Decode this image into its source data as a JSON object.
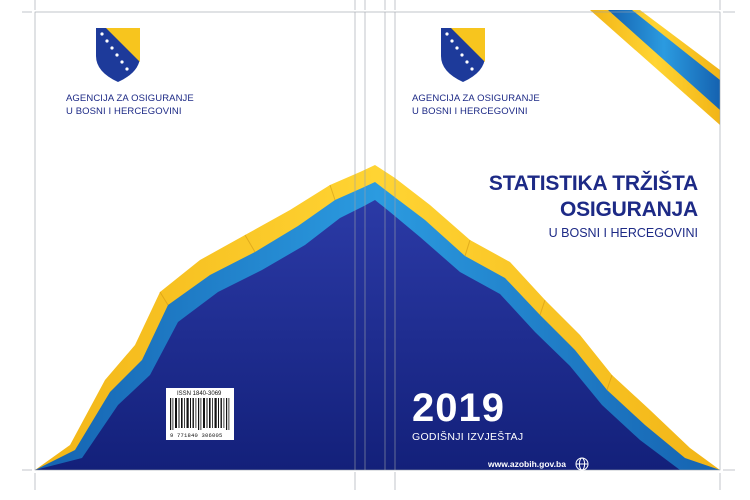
{
  "back_cover": {
    "agency_line1": "AGENCIJA ZA OSIGURANJE",
    "agency_line2": "U BOSNI I HERCEGOVINI",
    "issn": "ISSN 1840-3069",
    "barcode_digits": "9 771840 306005"
  },
  "front_cover": {
    "agency_line1": "AGENCIJA ZA OSIGURANJE",
    "agency_line2": "U BOSNI I HERCEGOVINI",
    "title_line1": "STATISTIKA TRŽIŠTA",
    "title_line2": "OSIGURANJA",
    "subtitle": "U BOSNI I HERCEGOVINI",
    "year": "2019",
    "report_type": "GODIŠNJI IZVJEŠTAJ",
    "website": "www.azobih.gov.ba"
  },
  "colors": {
    "navy": "#1d2a86",
    "blue": "#1f7fc5",
    "yellow": "#f7c51e"
  },
  "icons": [
    "coat-of-arms-icon",
    "globe-icon"
  ]
}
